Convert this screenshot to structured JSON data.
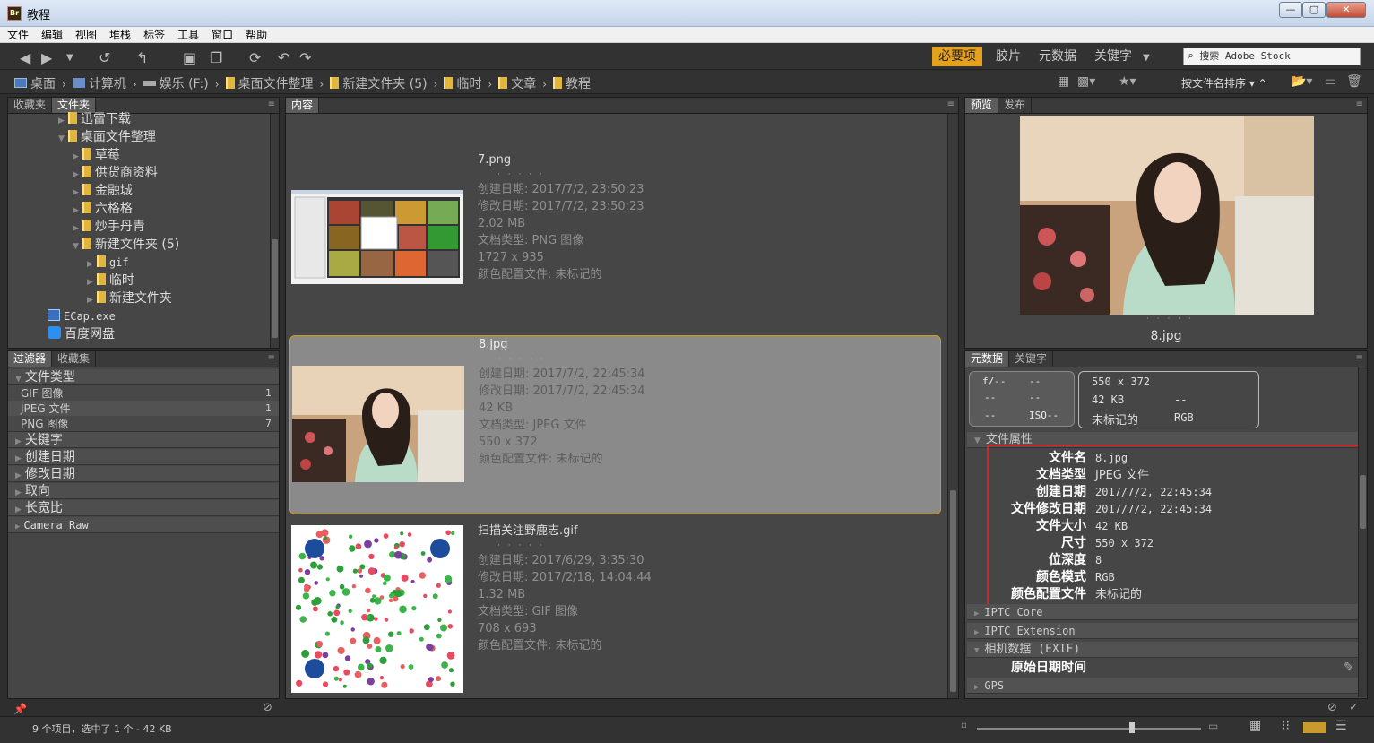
{
  "window": {
    "title": "教程",
    "app_icon": "Br",
    "minimize": "—",
    "maximize": "▢",
    "close": "✕"
  },
  "menu": [
    "文件",
    "编辑",
    "视图",
    "堆栈",
    "标签",
    "工具",
    "窗口",
    "帮助"
  ],
  "workspaces": [
    "必要项",
    "胶片",
    "元数据",
    "关键字"
  ],
  "search": {
    "placeholder": "搜索 Adobe Stock"
  },
  "breadcrumb": [
    "桌面",
    "计算机",
    "娱乐 (F:)",
    "桌面文件整理",
    "新建文件夹 (5)",
    "临时",
    "文章",
    "教程"
  ],
  "sort_label": "按文件名排序",
  "folders_panel": {
    "tabs": [
      "收藏夹",
      "文件夹"
    ],
    "tree": [
      {
        "label": "迅雷下载",
        "indent": 1,
        "icon": "folder"
      },
      {
        "label": "桌面文件整理",
        "indent": 1,
        "icon": "folder",
        "expanded": true
      },
      {
        "label": "草莓",
        "indent": 2,
        "icon": "folder"
      },
      {
        "label": "供货商资料",
        "indent": 2,
        "icon": "folder"
      },
      {
        "label": "金融城",
        "indent": 2,
        "icon": "folder"
      },
      {
        "label": "六格格",
        "indent": 2,
        "icon": "folder"
      },
      {
        "label": "炒手丹青",
        "indent": 2,
        "icon": "folder"
      },
      {
        "label": "新建文件夹 (5)",
        "indent": 2,
        "icon": "folder",
        "expanded": true
      },
      {
        "label": "gif",
        "indent": 3,
        "icon": "folder"
      },
      {
        "label": "临时",
        "indent": 3,
        "icon": "folder"
      },
      {
        "label": "新建文件夹",
        "indent": 3,
        "icon": "folder"
      },
      {
        "label": "ECap.exe",
        "indent": 0,
        "icon": "exe"
      },
      {
        "label": "百度网盘",
        "indent": 0,
        "icon": "cloud"
      }
    ]
  },
  "filter_panel": {
    "tabs": [
      "过滤器",
      "收藏集"
    ],
    "sections": [
      {
        "title": "文件类型",
        "items": [
          {
            "label": "GIF 图像",
            "count": "1"
          },
          {
            "label": "JPEG 文件",
            "count": "1"
          },
          {
            "label": "PNG 图像",
            "count": "7"
          }
        ]
      },
      {
        "title": "关键字"
      },
      {
        "title": "创建日期"
      },
      {
        "title": "修改日期"
      },
      {
        "title": "取向"
      },
      {
        "title": "长宽比"
      },
      {
        "title": "Camera Raw"
      }
    ]
  },
  "content_panel": {
    "tab": "内容",
    "items": [
      {
        "name": "7.png",
        "stars": "· · · · ·",
        "created": "创建日期: 2017/7/2, 23:50:23",
        "modified": "修改日期: 2017/7/2, 23:50:23",
        "size": "2.02 MB",
        "type": "文档类型: PNG 图像",
        "dims": "1727 x 935",
        "profile": "颜色配置文件: 未标记的",
        "selected": false
      },
      {
        "name": "8.jpg",
        "stars": "· · · · ·",
        "created": "创建日期: 2017/7/2, 22:45:34",
        "modified": "修改日期: 2017/7/2, 22:45:34",
        "size": "42 KB",
        "type": "文档类型: JPEG 文件",
        "dims": "550 x 372",
        "profile": "颜色配置文件: 未标记的",
        "selected": true
      },
      {
        "name": "扫描关注野鹿志.gif",
        "stars": "· · · · ·",
        "created": "创建日期: 2017/6/29, 3:35:30",
        "modified": "修改日期: 2017/2/18, 14:04:44",
        "size": "1.32 MB",
        "type": "文档类型: GIF 图像",
        "dims": "708 x 693",
        "profile": "颜色配置文件: 未标记的",
        "selected": false
      }
    ]
  },
  "preview_panel": {
    "tabs": [
      "预览",
      "发布"
    ],
    "stars": "· · · · ·",
    "filename": "8.jpg"
  },
  "metadata_panel": {
    "tabs": [
      "元数据",
      "关键字"
    ],
    "camera": {
      "f": "f/--",
      "a": "--",
      "b": "--",
      "c": "--",
      "d": "--",
      "iso": "ISO--"
    },
    "summary": {
      "dims": "550 x 372",
      "size": "42 KB",
      "dash": "--",
      "profile": "未标记的",
      "mode": "RGB"
    },
    "file_props_title": "文件属性",
    "file_props": [
      {
        "k": "文件名",
        "v": "8.jpg"
      },
      {
        "k": "文档类型",
        "v": "JPEG 文件"
      },
      {
        "k": "创建日期",
        "v": "2017/7/2, 22:45:34"
      },
      {
        "k": "文件修改日期",
        "v": "2017/7/2, 22:45:34"
      },
      {
        "k": "文件大小",
        "v": "42 KB"
      },
      {
        "k": "尺寸",
        "v": "550 x 372"
      },
      {
        "k": "位深度",
        "v": "8"
      },
      {
        "k": "颜色模式",
        "v": "RGB"
      },
      {
        "k": "颜色配置文件",
        "v": "未标记的"
      }
    ],
    "sections": [
      "IPTC Core",
      "IPTC Extension",
      "相机数据 (EXIF)",
      "GPS"
    ],
    "exif_row": "原始日期时间"
  },
  "status": {
    "text": "9 个项目，选中了 1 个 - 42 KB"
  },
  "colors": {
    "accent": "#e3a11d",
    "highlight_box": "#d8232a"
  }
}
